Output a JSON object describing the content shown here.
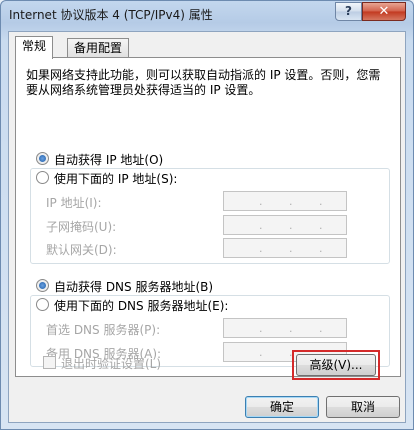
{
  "window": {
    "title": "Internet 协议版本 4 (TCP/IPv4) 属性",
    "help_label": "?",
    "close_label": "✕"
  },
  "tabs": [
    {
      "label": "常规",
      "active": true
    },
    {
      "label": "备用配置",
      "active": false
    }
  ],
  "description": "如果网络支持此功能，则可以获取自动指派的 IP 设置。否则，您需要从网络系统管理员处获得适当的 IP 设置。",
  "ip": {
    "auto_label": "自动获得 IP 地址(O)",
    "auto_selected": true,
    "manual_label": "使用下面的 IP 地址(S):",
    "fields": [
      {
        "label": "IP 地址(I):",
        "value": ""
      },
      {
        "label": "子网掩码(U):",
        "value": ""
      },
      {
        "label": "默认网关(D):",
        "value": ""
      }
    ]
  },
  "dns": {
    "auto_label": "自动获得 DNS 服务器地址(B)",
    "auto_selected": true,
    "manual_label": "使用下面的 DNS 服务器地址(E):",
    "fields": [
      {
        "label": "首选 DNS 服务器(P):",
        "value": ""
      },
      {
        "label": "备用 DNS 服务器(A):",
        "value": ""
      }
    ]
  },
  "validate_checkbox": {
    "label": "退出时验证设置(L)",
    "checked": false
  },
  "buttons": {
    "advanced": "高级(V)...",
    "ok": "确定",
    "cancel": "取消"
  },
  "colors": {
    "highlight": "#d42a2a",
    "disabled_text": "#a6a6a6"
  }
}
